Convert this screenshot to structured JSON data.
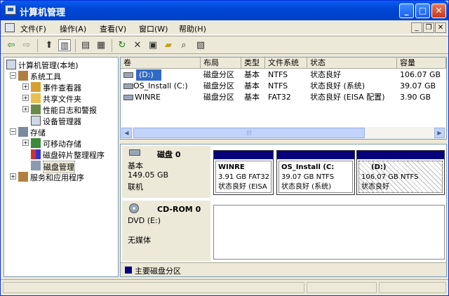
{
  "title": "计算机管理",
  "menu": [
    "文件(F)",
    "操作(A)",
    "查看(V)",
    "窗口(W)",
    "帮助(H)"
  ],
  "mdi": {
    "min": "_",
    "restore": "❐",
    "close": "✕"
  },
  "tree": [
    {
      "label": "计算机管理(本地)"
    },
    {
      "label": "系统工具"
    },
    {
      "label": "事件查看器"
    },
    {
      "label": "共享文件夹"
    },
    {
      "label": "性能日志和警报"
    },
    {
      "label": "设备管理器"
    },
    {
      "label": "存储"
    },
    {
      "label": "可移动存储"
    },
    {
      "label": "磁盘碎片整理程序"
    },
    {
      "label": "磁盘管理"
    },
    {
      "label": "服务和应用程序"
    }
  ],
  "columns": [
    "卷",
    "布局",
    "类型",
    "文件系统",
    "状态",
    "容量"
  ],
  "volumes": [
    {
      "name": "(D:)",
      "layout": "磁盘分区",
      "type": "基本",
      "fs": "NTFS",
      "status": "状态良好",
      "capacity": "106.07 GB"
    },
    {
      "name": "OS_Install (C:)",
      "layout": "磁盘分区",
      "type": "基本",
      "fs": "NTFS",
      "status": "状态良好 (系统)",
      "capacity": "39.07 GB"
    },
    {
      "name": "WINRE",
      "layout": "磁盘分区",
      "type": "基本",
      "fs": "FAT32",
      "status": "状态良好 (EISA 配置)",
      "capacity": "3.90 GB"
    }
  ],
  "scroll_thumb": "|||",
  "disk0": {
    "name": "磁盘 0",
    "kind": "基本",
    "size": "149.05 GB",
    "state": "联机"
  },
  "partitions": [
    {
      "name": "WINRE",
      "info": "3.91 GB FAT32",
      "status": "状态良好 (EISA"
    },
    {
      "name": "OS_Install  (C:",
      "info": "39.07 GB NTFS",
      "status": "状态良好 (系统)"
    },
    {
      "name": "(D:)",
      "info": "106.07 GB NTFS",
      "status": "状态良好"
    }
  ],
  "cdrom": {
    "name": "CD-ROM 0",
    "kind": "DVD (E:)",
    "state": "无媒体"
  },
  "legend": "主要磁盘分区",
  "colors": {
    "primary_partition": "#08007A",
    "title": "#0047D6"
  }
}
